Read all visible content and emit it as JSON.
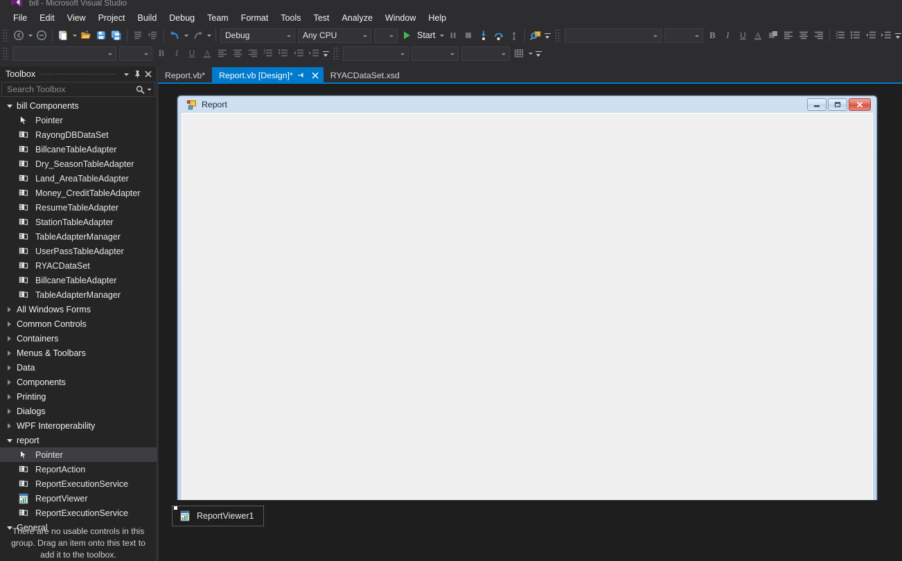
{
  "window": {
    "title": "bill - Microsoft Visual Studio",
    "app_icon": "visual-studio-icon"
  },
  "menubar": {
    "items": [
      {
        "label": "File"
      },
      {
        "label": "Edit"
      },
      {
        "label": "View"
      },
      {
        "label": "Project"
      },
      {
        "label": "Build"
      },
      {
        "label": "Debug"
      },
      {
        "label": "Team"
      },
      {
        "label": "Format"
      },
      {
        "label": "Tools"
      },
      {
        "label": "Test"
      },
      {
        "label": "Analyze"
      },
      {
        "label": "Window"
      },
      {
        "label": "Help"
      }
    ]
  },
  "toolbar": {
    "configuration": "Debug",
    "platform": "Any CPU",
    "start_label": "Start",
    "navigate_back_icon": "navigate-back-icon",
    "navigate_forward_icon": "navigate-forward-icon",
    "new_item_icon": "new-item-icon",
    "open_file_icon": "open-file-icon",
    "save_icon": "save-icon",
    "save_all_icon": "save-all-icon",
    "comment_icon": "comment-selection-icon",
    "uncomment_icon": "uncomment-selection-icon",
    "undo_icon": "undo-icon",
    "redo_icon": "redo-icon",
    "start_icon": "start-debug-icon",
    "pause_icon": "pause-icon",
    "stop_icon": "stop-icon",
    "step_into_icon": "step-into-icon",
    "step_over_icon": "step-over-icon",
    "step_out_icon": "step-out-icon",
    "find_icon": "find-in-files-icon",
    "font_family": "",
    "font_size": "",
    "bold_label": "B",
    "italic_label": "I",
    "underline_label": "U",
    "foreground_label": "A",
    "background_icon": "background-color-icon",
    "align_left_icon": "align-left-icon",
    "align_center_icon": "align-center-icon",
    "align_right_icon": "align-right-icon",
    "ordered_list_icon": "ordered-list-icon",
    "unordered_list_icon": "unordered-list-icon",
    "outdent_icon": "outdent-icon",
    "indent_icon": "indent-icon",
    "style_combo": "",
    "block_format_combo": "",
    "target_combo": "",
    "table_icon": "insert-table-icon",
    "overflow_label": "Toolbar Options"
  },
  "toolbox": {
    "title": "Toolbox",
    "dropdown_icon": "chevron-down-icon",
    "pin_icon": "pin-icon",
    "close_icon": "close-icon",
    "search_placeholder": "Search Toolbox",
    "search_value": "",
    "search_icon": "search-icon",
    "search_dropdown_icon": "chevron-down-icon",
    "empty_message": "There are no usable controls in this group. Drag an item onto this text to add it to the toolbox.",
    "groups": [
      {
        "label": "bill Components",
        "expanded": true,
        "items": [
          {
            "label": "Pointer",
            "icon": "pointer-icon",
            "selected": false
          },
          {
            "label": "RayongDBDataSet",
            "icon": "component-icon",
            "selected": false
          },
          {
            "label": "BillcaneTableAdapter",
            "icon": "component-icon",
            "selected": false
          },
          {
            "label": "Dry_SeasonTableAdapter",
            "icon": "component-icon",
            "selected": false
          },
          {
            "label": "Land_AreaTableAdapter",
            "icon": "component-icon",
            "selected": false
          },
          {
            "label": "Money_CreditTableAdapter",
            "icon": "component-icon",
            "selected": false
          },
          {
            "label": "ResumeTableAdapter",
            "icon": "component-icon",
            "selected": false
          },
          {
            "label": "StationTableAdapter",
            "icon": "component-icon",
            "selected": false
          },
          {
            "label": "TableAdapterManager",
            "icon": "component-icon",
            "selected": false
          },
          {
            "label": "UserPassTableAdapter",
            "icon": "component-icon",
            "selected": false
          },
          {
            "label": "RYACDataSet",
            "icon": "component-icon",
            "selected": false
          },
          {
            "label": "BillcaneTableAdapter",
            "icon": "component-icon",
            "selected": false
          },
          {
            "label": "TableAdapterManager",
            "icon": "component-icon",
            "selected": false
          }
        ]
      },
      {
        "label": "All Windows Forms",
        "expanded": false,
        "items": []
      },
      {
        "label": "Common Controls",
        "expanded": false,
        "items": []
      },
      {
        "label": "Containers",
        "expanded": false,
        "items": []
      },
      {
        "label": "Menus & Toolbars",
        "expanded": false,
        "items": []
      },
      {
        "label": "Data",
        "expanded": false,
        "items": []
      },
      {
        "label": "Components",
        "expanded": false,
        "items": []
      },
      {
        "label": "Printing",
        "expanded": false,
        "items": []
      },
      {
        "label": "Dialogs",
        "expanded": false,
        "items": []
      },
      {
        "label": "WPF Interoperability",
        "expanded": false,
        "items": []
      },
      {
        "label": "report",
        "expanded": true,
        "items": [
          {
            "label": "Pointer",
            "icon": "pointer-icon",
            "selected": true
          },
          {
            "label": "ReportAction",
            "icon": "component-icon",
            "selected": false
          },
          {
            "label": "ReportExecutionService",
            "icon": "component-icon",
            "selected": false
          },
          {
            "label": "ReportViewer",
            "icon": "report-viewer-icon",
            "selected": false
          },
          {
            "label": "ReportExecutionService",
            "icon": "component-icon",
            "selected": false
          }
        ]
      },
      {
        "label": "General",
        "expanded": true,
        "items": []
      }
    ]
  },
  "tabs": [
    {
      "label": "Report.vb*",
      "active": false
    },
    {
      "label": "Report.vb [Design]*",
      "active": true,
      "pin_icon": "pin-icon",
      "close_icon": "close-icon"
    },
    {
      "label": "RYACDataSet.xsd",
      "active": false
    }
  ],
  "designer": {
    "form_title": "Report",
    "form_icon": "windows-form-icon",
    "minimize_icon": "minimize-icon",
    "maximize_icon": "maximize-icon",
    "close_icon": "close-icon",
    "tray_items": [
      {
        "label": "ReportViewer1",
        "icon": "report-viewer-icon",
        "selected": true
      }
    ]
  },
  "colors": {
    "accent": "#007acc",
    "shell_bg": "#2d2d30",
    "panel_bg": "#252526",
    "designer_bg": "#1e1e1e",
    "form_chrome": "#c3d7ec",
    "close_red": "#d4503c",
    "start_green": "#4caf50",
    "undo_blue": "#3a8fd4"
  }
}
